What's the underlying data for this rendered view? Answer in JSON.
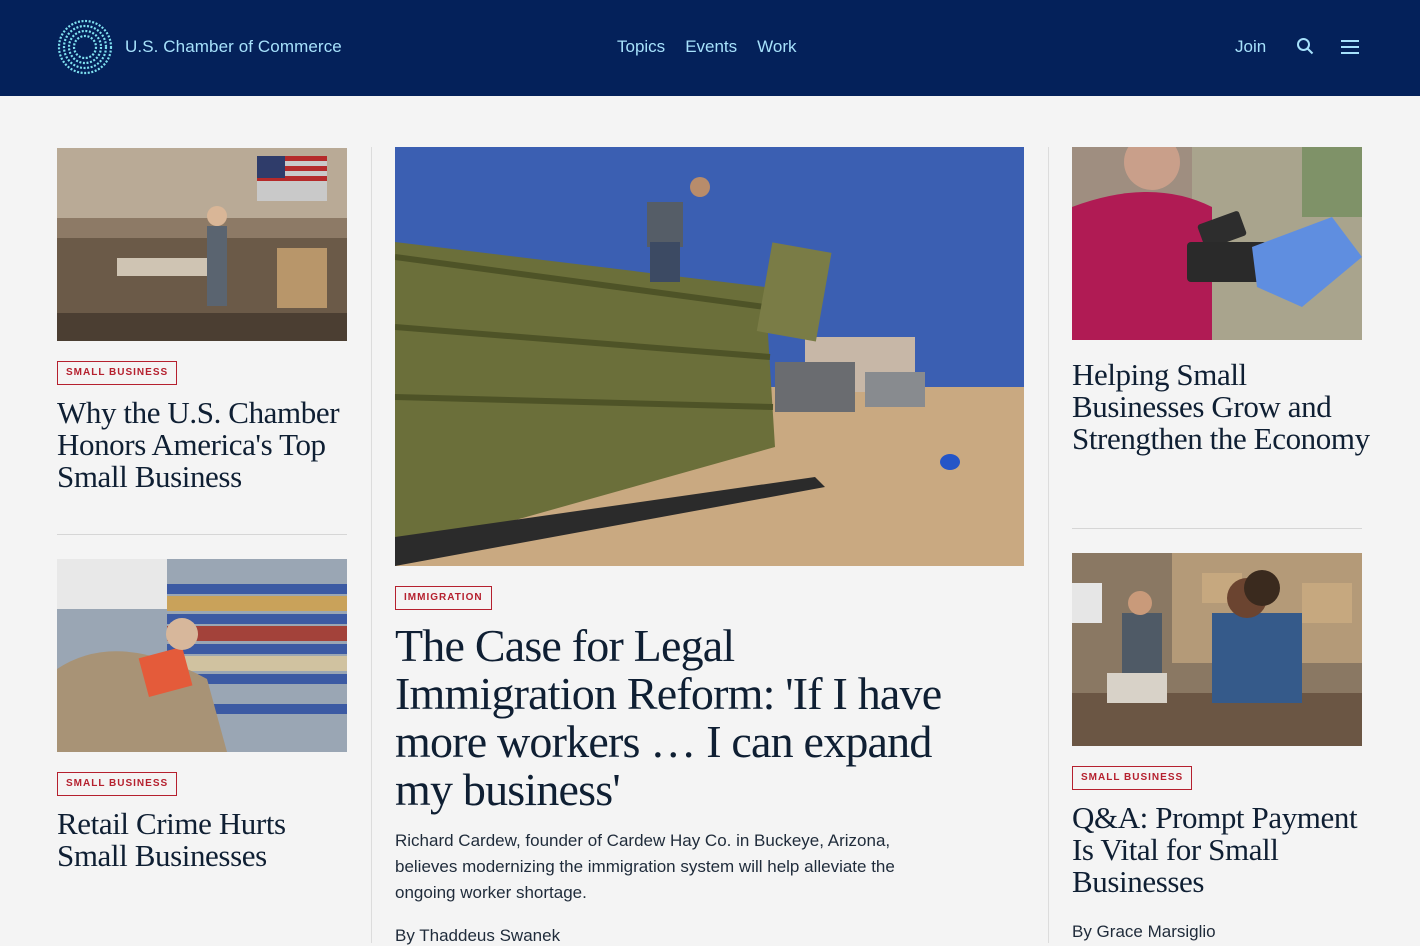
{
  "header": {
    "brand": "U.S. Chamber of Commerce",
    "nav": [
      "Topics",
      "Events",
      "Work"
    ],
    "join": "Join"
  },
  "left": {
    "card1": {
      "tag": "SMALL BUSINESS",
      "title": "Why the U.S. Chamber Honors America's Top Small Business"
    },
    "card2": {
      "tag": "SMALL BUSINESS",
      "title": "Retail Crime Hurts Small Businesses"
    }
  },
  "center": {
    "tag": "IMMIGRATION",
    "title": "The Case for Legal Immigration Reform: 'If I have more workers … I can expand my business'",
    "summary": "Richard Cardew, founder of Cardew Hay Co. in Buckeye, Arizona, believes modernizing the immigration system will help alleviate the ongoing worker shortage.",
    "byline": "By Thaddeus Swanek"
  },
  "right": {
    "card1": {
      "title": "Helping Small Businesses Grow and Strengthen the Economy"
    },
    "card2": {
      "tag": "SMALL BUSINESS",
      "title": "Q&A: Prompt Payment Is Vital for Small Businesses",
      "byline": "By Grace Marsiglio"
    }
  },
  "colors": {
    "header_bg": "#04215a",
    "accent": "#a6e1fb",
    "tag": "#b5202e"
  }
}
